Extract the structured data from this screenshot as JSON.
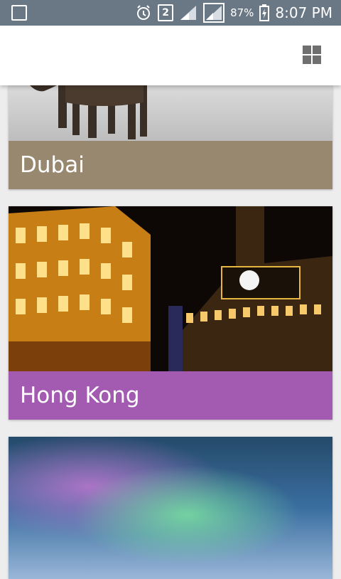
{
  "status_bar": {
    "sim": "2",
    "battery": "87%",
    "time": "8:07 PM",
    "icons": [
      "gallery-icon",
      "alarm-icon",
      "signal-icon",
      "signal-icon",
      "battery-charging-icon"
    ]
  },
  "app_bar": {
    "layout_toggle_icon": "grid-view-icon"
  },
  "cards": [
    {
      "label": "Dubai",
      "color": "#998870"
    },
    {
      "label": "Hong Kong",
      "color": "#a35ab1"
    },
    {
      "label": "",
      "color": "#3a6ea0"
    }
  ]
}
